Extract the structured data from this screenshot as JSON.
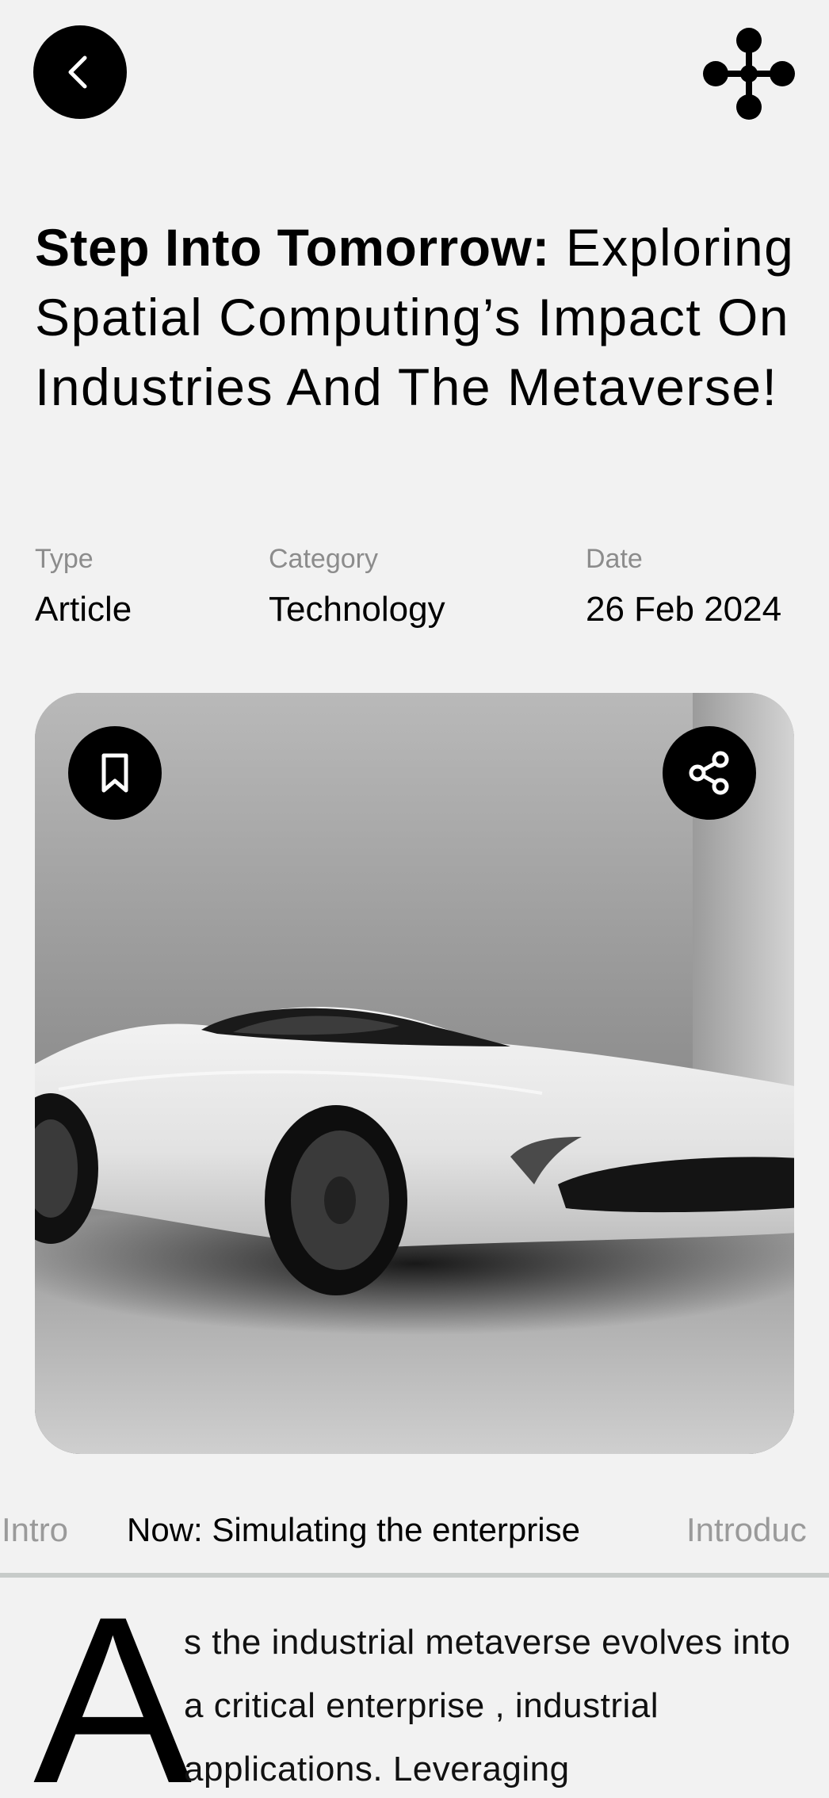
{
  "header": {
    "back_icon": "chevron-left-icon",
    "menu_icon": "four-dot-cross-icon"
  },
  "article": {
    "title_bold": "Step Into Tomorrow:",
    "title_rest": "Exploring Spatial Computing’s Impact On Industries And The Metaverse!",
    "meta": {
      "type_label": "Type",
      "type_value": "Article",
      "category_label": "Category",
      "category_value": "Technology",
      "date_label": "Date",
      "date_value": "26 Feb 2024"
    },
    "hero": {
      "bookmark_icon": "bookmark-icon",
      "share_icon": "share-icon"
    },
    "tabs": [
      "Intro",
      "Now: Simulating the enterprise",
      "Introduc"
    ],
    "active_tab": "Now: Simulating the enterprise",
    "drop_cap": "A",
    "body": "s the industrial metaverse evolves into a critical enterprise , industrial applications. Leveraging"
  },
  "colors": {
    "background": "#f2f2f2",
    "accent": "#000000",
    "muted_text": "#8c8c8c",
    "divider": "#c7cbc9"
  }
}
